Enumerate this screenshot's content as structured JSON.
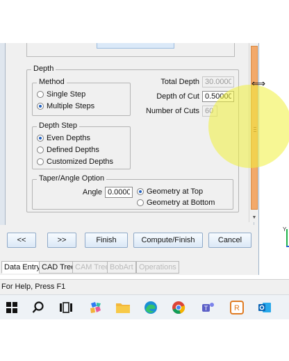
{
  "depth_group": {
    "title": "Depth",
    "method": {
      "title": "Method",
      "options": [
        "Single Step",
        "Multiple Steps"
      ],
      "selected": "Multiple Steps"
    },
    "total_depth": {
      "label": "Total Depth",
      "value": "30.00000",
      "enabled": false
    },
    "depth_of_cut": {
      "label": "Depth of Cut",
      "value": "0.50000",
      "enabled": true
    },
    "number_of_cuts": {
      "label": "Number of Cuts",
      "value": "60",
      "enabled": false
    },
    "depth_step": {
      "title": "Depth Step",
      "options": [
        "Even Depths",
        "Defined Depths",
        "Customized Depths"
      ],
      "selected": "Even Depths"
    },
    "taper": {
      "title": "Taper/Angle Option",
      "angle_label": "Angle",
      "angle_value": "0.00000",
      "options": [
        "Geometry at Top",
        "Geometry at Bottom"
      ],
      "selected": "Geometry at Top"
    }
  },
  "buttons": {
    "prev": "<<",
    "next": ">>",
    "finish": "Finish",
    "compute_finish": "Compute/Finish",
    "cancel": "Cancel"
  },
  "tabs": [
    {
      "label": "Data Entry",
      "active": true,
      "enabled": true
    },
    {
      "label": "CAD Tree",
      "active": false,
      "enabled": true
    },
    {
      "label": "CAM Tree",
      "active": false,
      "enabled": false
    },
    {
      "label": "BobArt",
      "active": false,
      "enabled": false
    },
    {
      "label": "Operations",
      "active": false,
      "enabled": false
    }
  ],
  "status_text": "For Help, Press F1",
  "triad_label": "Y",
  "taskbar_icons": [
    "windows-start",
    "search",
    "task-view",
    "copilot",
    "file-explorer",
    "edge",
    "chrome",
    "teams",
    "remote-app",
    "outlook"
  ],
  "colors": {
    "scroll_thumb": "#f3a96a",
    "highlight": "#f0f03c",
    "button_top": "#f7fbff",
    "button_bottom": "#dbe8f6"
  }
}
